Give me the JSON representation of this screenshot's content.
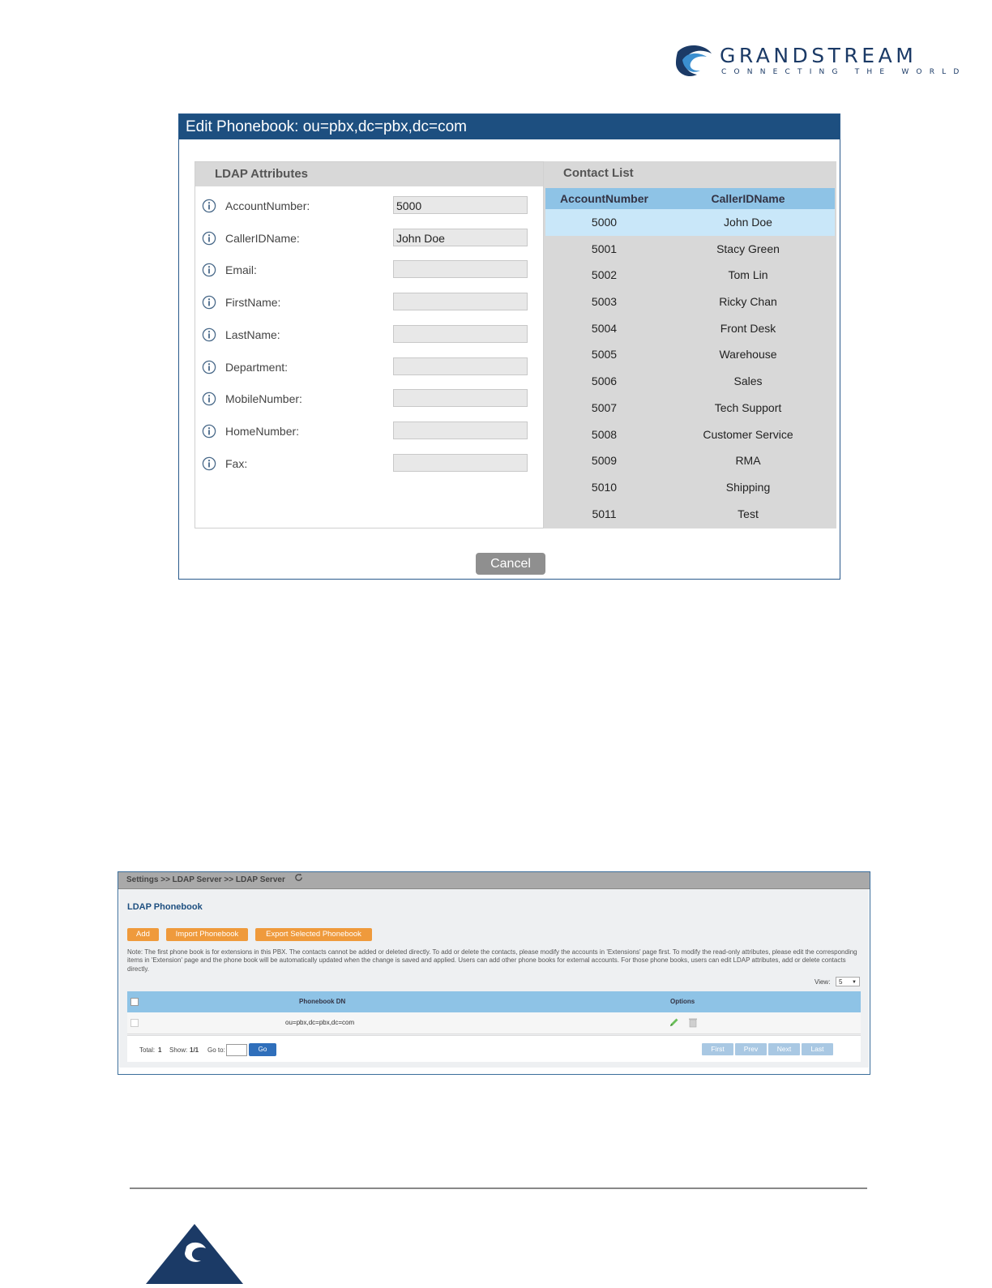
{
  "logo": {
    "name": "GRANDSTREAM",
    "tagline": "CONNECTING THE WORLD"
  },
  "dialog": {
    "title": "Edit Phonebook: ou=pbx,dc=pbx,dc=com",
    "attributes_header": "LDAP Attributes",
    "attributes": [
      {
        "label": "AccountNumber:",
        "value": "5000"
      },
      {
        "label": "CallerIDName:",
        "value": "John Doe"
      },
      {
        "label": "Email:",
        "value": ""
      },
      {
        "label": "FirstName:",
        "value": ""
      },
      {
        "label": "LastName:",
        "value": ""
      },
      {
        "label": "Department:",
        "value": ""
      },
      {
        "label": "MobileNumber:",
        "value": ""
      },
      {
        "label": "HomeNumber:",
        "value": ""
      },
      {
        "label": "Fax:",
        "value": ""
      }
    ],
    "contact_header": "Contact List",
    "contact_columns": [
      "AccountNumber",
      "CallerIDName"
    ],
    "contacts": [
      {
        "number": "5000",
        "name": "John Doe",
        "selected": true
      },
      {
        "number": "5001",
        "name": "Stacy Green"
      },
      {
        "number": "5002",
        "name": "Tom Lin"
      },
      {
        "number": "5003",
        "name": "Ricky Chan"
      },
      {
        "number": "5004",
        "name": "Front Desk"
      },
      {
        "number": "5005",
        "name": "Warehouse"
      },
      {
        "number": "5006",
        "name": "Sales"
      },
      {
        "number": "5007",
        "name": "Tech Support"
      },
      {
        "number": "5008",
        "name": "Customer Service"
      },
      {
        "number": "5009",
        "name": "RMA"
      },
      {
        "number": "5010",
        "name": "Shipping"
      },
      {
        "number": "5011",
        "name": "Test"
      }
    ],
    "cancel_label": "Cancel"
  },
  "ldap_page": {
    "breadcrumb": "Settings >> LDAP Server >> LDAP Server",
    "title": "LDAP Phonebook",
    "buttons": {
      "add": "Add",
      "import": "Import Phonebook",
      "export": "Export Selected Phonebook"
    },
    "note": "Note: The first phone book is for extensions in this PBX. The contacts cannot be added or deleted directly. To add or delete the contacts, please modify the accounts in 'Extensions' page first. To modify the read-only attributes, please edit the corresponding items in 'Extension' page and the phone book will be automatically updated when the change is saved and applied. Users can add other phone books for external accounts. For those phone books, users can edit LDAP attributes, add or delete contacts directly.",
    "view_label": "View:",
    "view_value": "5",
    "columns": {
      "dn": "Phonebook DN",
      "options": "Options"
    },
    "rows": [
      {
        "dn": "ou=pbx,dc=pbx,dc=com"
      }
    ],
    "pager": {
      "total_label": "Total:",
      "total": "1",
      "show_label": "Show:",
      "show": "1/1",
      "goto_label": "Go to:",
      "go": "Go",
      "first": "First",
      "prev": "Prev",
      "next": "Next",
      "last": "Last"
    }
  },
  "colors": {
    "brand": "#1b3a66",
    "title_bar": "#1d4f80",
    "table_header": "#8ec3e6",
    "selected_row": "#c9e7f9",
    "orange_button": "#ef9a3c"
  }
}
